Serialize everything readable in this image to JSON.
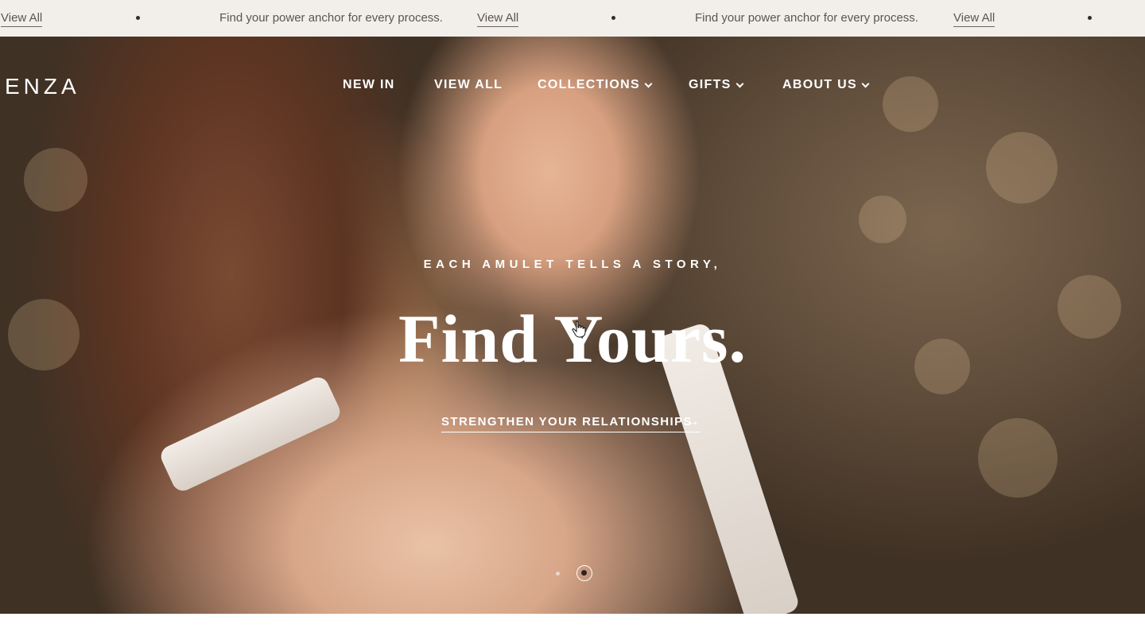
{
  "announcement": {
    "message": "Find your power anchor for every process.",
    "link_label": "View All"
  },
  "header": {
    "logo_text": "ENZA",
    "nav": [
      {
        "label": "NEW IN",
        "has_dropdown": false
      },
      {
        "label": "VIEW ALL",
        "has_dropdown": false
      },
      {
        "label": "COLLECTIONS",
        "has_dropdown": true
      },
      {
        "label": "GIFTS",
        "has_dropdown": true
      },
      {
        "label": "ABOUT US",
        "has_dropdown": true
      }
    ]
  },
  "hero": {
    "eyebrow": "EACH AMULET TELLS A STORY,",
    "headline": "Find Yours.",
    "cta_label": "STRENGTHEN YOUR RELATIONSHIPS",
    "cta_icon": "arrow-right-icon",
    "slides_total": 2,
    "active_slide": 2
  },
  "colors": {
    "announcement_bg": "#f2efeb",
    "announcement_text": "#5a5550",
    "hero_text": "#ffffff"
  }
}
